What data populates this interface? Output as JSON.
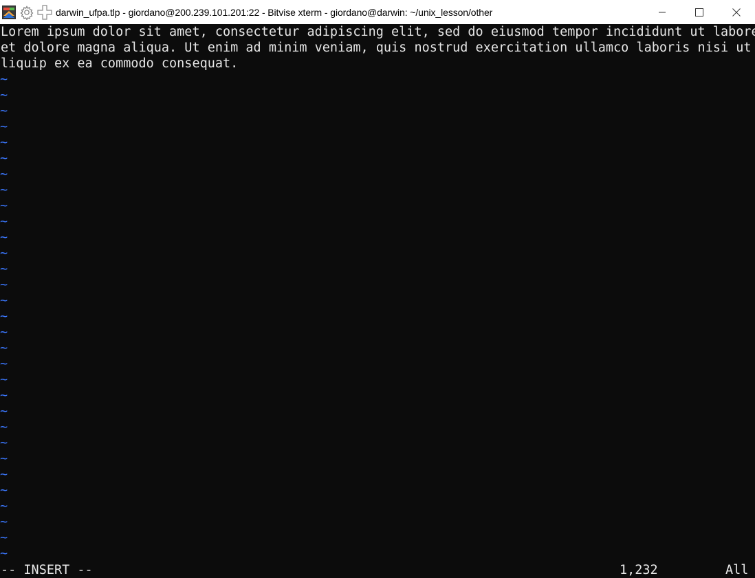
{
  "window": {
    "title": "darwin_ufpa.tlp - giordano@200.239.101.201:22 - Bitvise xterm - giordano@darwin: ~/unix_lesson/other",
    "icons": [
      "bitvise-app-icon",
      "gear-icon",
      "plus-icon"
    ],
    "controls": [
      "minimize-icon",
      "maximize-icon",
      "close-icon"
    ]
  },
  "editor": {
    "lines": [
      "Lorem ipsum dolor sit amet, consectetur adipiscing elit, sed do eiusmod tempor incididunt ut labore",
      "et dolore magna aliqua. Ut enim ad minim veniam, quis nostrud exercitation ullamco laboris nisi ut a",
      "liquip ex ea commodo consequat."
    ],
    "empty_line_marker": "~",
    "empty_line_count": 31,
    "colors": {
      "background": "#0c0c0c",
      "text": "#e6e6e6",
      "tilde": "#3b78ff"
    }
  },
  "statusline": {
    "mode": "-- INSERT --",
    "cursor_position": "1,232",
    "scroll": "All"
  }
}
